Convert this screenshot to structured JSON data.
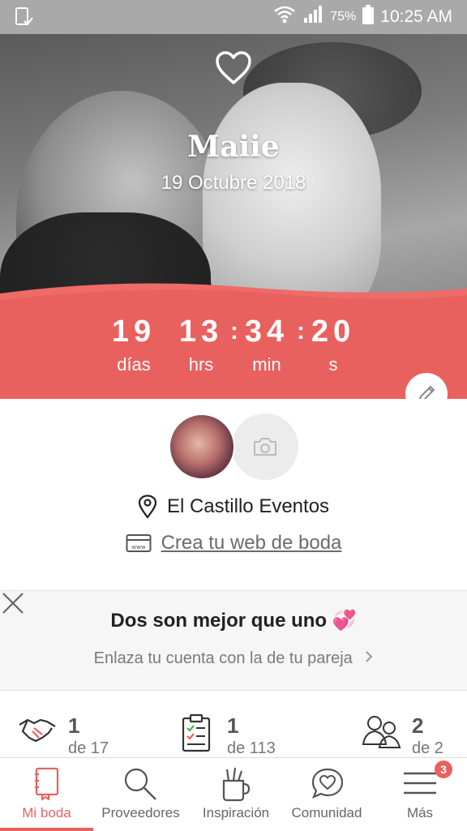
{
  "status_bar": {
    "battery_percent": "75%",
    "time": "10:25 AM"
  },
  "hero": {
    "couple_name": "Maiie",
    "wedding_date": "19 Octubre 2018"
  },
  "countdown": {
    "days": "19",
    "hours": "13",
    "minutes": "34",
    "seconds": "20",
    "days_label": "días",
    "hours_label": "hrs",
    "minutes_label": "min",
    "seconds_label": "s"
  },
  "profile": {
    "venue": "El Castillo Eventos",
    "website_link": "Crea tu web de boda"
  },
  "promo": {
    "title": "Dos son mejor que uno 💞",
    "subtitle": "Enlaza tu cuenta con la de tu pareja"
  },
  "stats": [
    {
      "icon": "handshake-icon",
      "count": "1",
      "sub": "de 17"
    },
    {
      "icon": "checklist-icon",
      "count": "1",
      "sub": "de 113"
    },
    {
      "icon": "guests-icon",
      "count": "2",
      "sub": "de 2"
    }
  ],
  "nav": {
    "items": [
      {
        "label": "Mi boda",
        "icon": "notebook-icon"
      },
      {
        "label": "Proveedores",
        "icon": "search-icon"
      },
      {
        "label": "Inspiración",
        "icon": "brush-cup-icon"
      },
      {
        "label": "Comunidad",
        "icon": "chat-heart-icon"
      },
      {
        "label": "Más",
        "icon": "menu-icon"
      }
    ],
    "more_badge": "3"
  },
  "colors": {
    "accent": "#e9615f",
    "status_bar": "#a9a9a9"
  }
}
